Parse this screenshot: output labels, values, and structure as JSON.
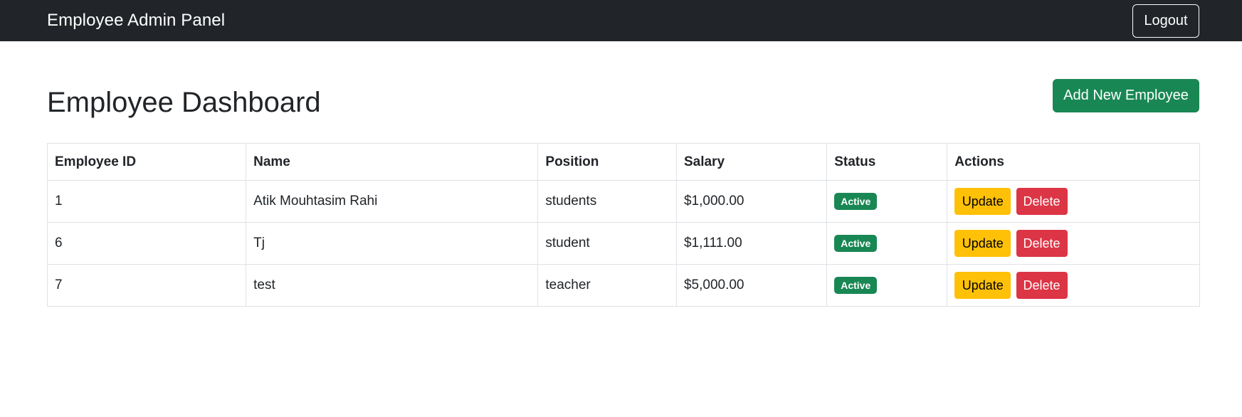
{
  "navbar": {
    "brand": "Employee Admin Panel",
    "logout_label": "Logout"
  },
  "page": {
    "title": "Employee Dashboard",
    "add_button_label": "Add New Employee"
  },
  "table": {
    "headers": [
      "Employee ID",
      "Name",
      "Position",
      "Salary",
      "Status",
      "Actions"
    ],
    "rows": [
      {
        "id": "1",
        "name": "Atik Mouhtasim Rahi",
        "position": "students",
        "salary": "$1,000.00",
        "status": "Active",
        "update_label": "Update",
        "delete_label": "Delete"
      },
      {
        "id": "6",
        "name": "Tj",
        "position": "student",
        "salary": "$1,111.00",
        "status": "Active",
        "update_label": "Update",
        "delete_label": "Delete"
      },
      {
        "id": "7",
        "name": "test",
        "position": "teacher",
        "salary": "$5,000.00",
        "status": "Active",
        "update_label": "Update",
        "delete_label": "Delete"
      }
    ]
  },
  "colors": {
    "navbar_bg": "#212529",
    "success": "#198754",
    "warning": "#ffc107",
    "danger": "#dc3545"
  }
}
